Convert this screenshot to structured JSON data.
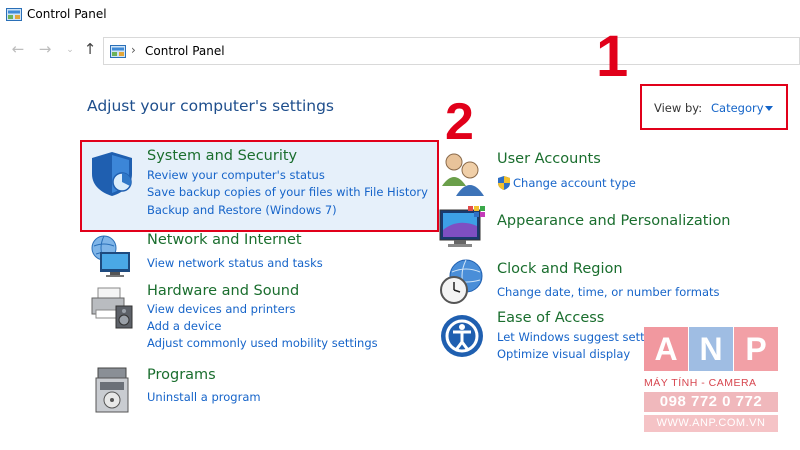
{
  "window": {
    "title": "Control Panel"
  },
  "address": {
    "crumb_sep": "›",
    "crumb": "Control Panel"
  },
  "main": {
    "heading": "Adjust your computer's settings",
    "view_by": {
      "label": "View by:",
      "value": "Category"
    }
  },
  "markers": [
    "1",
    "2"
  ],
  "categories": [
    {
      "title": "System and Security",
      "links": [
        "Review your computer's status",
        "Save backup copies of your files with File History",
        "Backup and Restore (Windows 7)"
      ]
    },
    {
      "title": "Network and Internet",
      "links": [
        "View network status and tasks"
      ]
    },
    {
      "title": "Hardware and Sound",
      "links": [
        "View devices and printers",
        "Add a device",
        "Adjust commonly used mobility settings"
      ]
    },
    {
      "title": "Programs",
      "links": [
        "Uninstall a program"
      ]
    },
    {
      "title": "User Accounts",
      "links": [
        "Change account type"
      ]
    },
    {
      "title": "Appearance and Personalization",
      "links": []
    },
    {
      "title": "Clock and Region",
      "links": [
        "Change date, time, or number formats"
      ]
    },
    {
      "title": "Ease of Access",
      "links": [
        "Let Windows suggest settings",
        "Optimize visual display"
      ]
    }
  ],
  "watermark": {
    "letters": [
      "A",
      "N",
      "P"
    ],
    "tagline": "MÁY TÍNH - CAMERA",
    "phone": "098 772 0 772",
    "website": "WWW.ANP.COM.VN"
  },
  "colors": {
    "accent_red": "#e1001a",
    "link_blue": "#1664c9",
    "title_green": "#1a6e2e",
    "heading_blue": "#1e4e8c"
  },
  "icons": [
    "control-panel-icon",
    "back-arrow-icon",
    "forward-arrow-icon",
    "chevron-down-icon",
    "up-arrow-icon",
    "shield-icon",
    "network-icon",
    "printer-icon",
    "programs-icon",
    "users-icon",
    "uac-shield-icon",
    "display-icon",
    "clock-globe-icon",
    "ease-of-access-icon"
  ]
}
